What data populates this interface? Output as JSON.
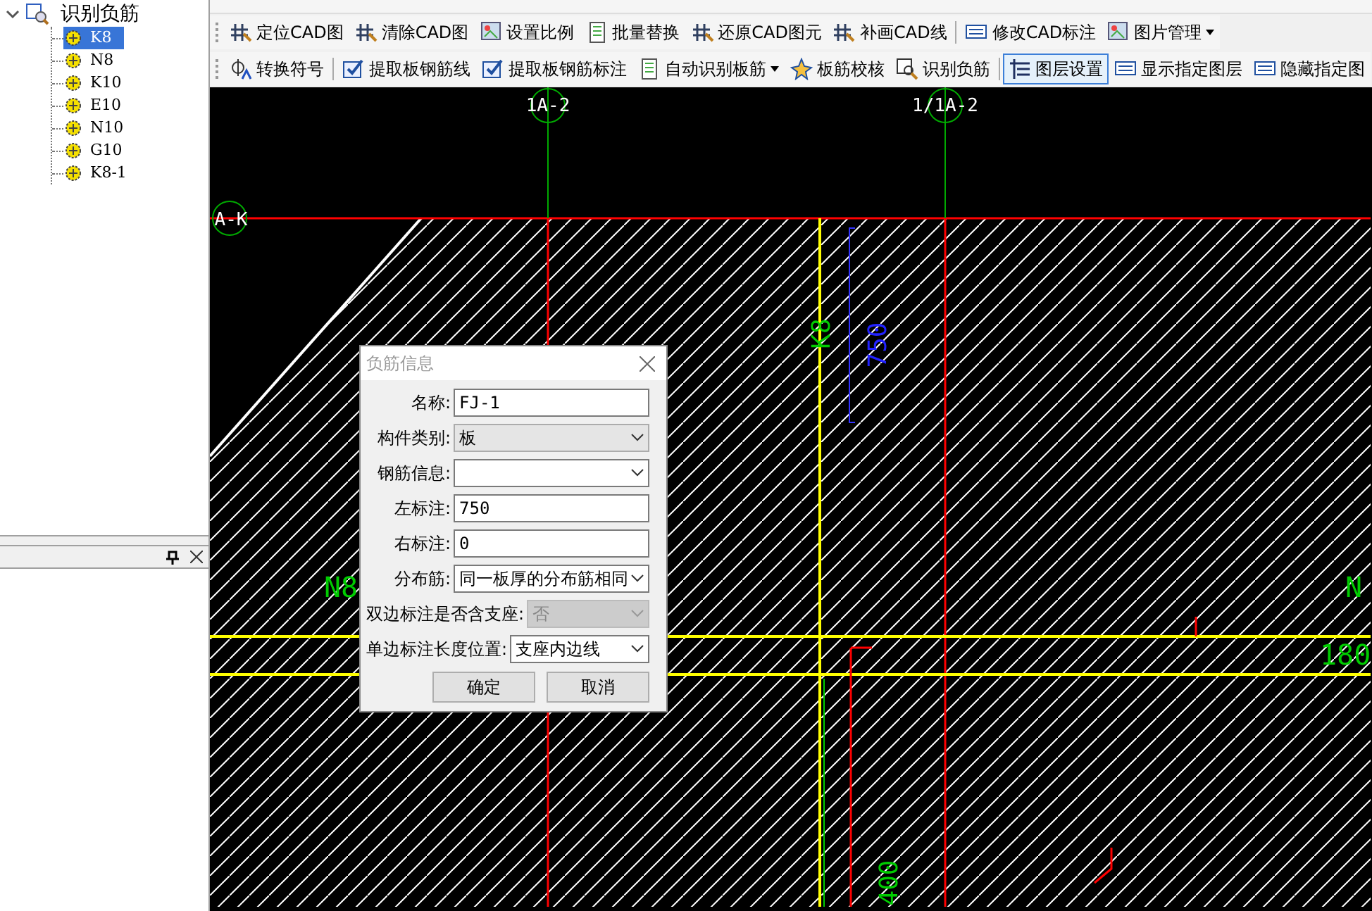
{
  "tree": {
    "label": "识别负筋",
    "expanded": true,
    "children": [
      {
        "label": "K8",
        "selected": true
      },
      {
        "label": "N8",
        "selected": false
      },
      {
        "label": "K10",
        "selected": false
      },
      {
        "label": "E10",
        "selected": false
      },
      {
        "label": "N10",
        "selected": false
      },
      {
        "label": "G10",
        "selected": false
      },
      {
        "label": "K8-1",
        "selected": false
      }
    ]
  },
  "toolbar_rows": [
    [
      {
        "label": "定位CAD图",
        "dropdown": false,
        "pressed": false
      },
      {
        "label": "清除CAD图",
        "dropdown": false,
        "pressed": false
      },
      {
        "label": "设置比例",
        "dropdown": false,
        "pressed": false
      },
      {
        "label": "批量替换",
        "dropdown": false,
        "pressed": false
      },
      {
        "label": "还原CAD图元",
        "dropdown": false,
        "pressed": false
      },
      {
        "label": "补画CAD线",
        "dropdown": false,
        "pressed": false
      },
      {
        "label": "修改CAD标注",
        "dropdown": false,
        "pressed": false
      },
      {
        "label": "图片管理",
        "dropdown": true,
        "pressed": false
      }
    ],
    [
      {
        "label": "转换符号",
        "dropdown": false,
        "pressed": false
      },
      {
        "label": "提取板钢筋线",
        "dropdown": false,
        "pressed": false
      },
      {
        "label": "提取板钢筋标注",
        "dropdown": false,
        "pressed": false
      },
      {
        "label": "自动识别板筋",
        "dropdown": true,
        "pressed": false
      },
      {
        "label": "板筋校核",
        "dropdown": false,
        "pressed": false
      },
      {
        "label": "识别负筋",
        "dropdown": false,
        "pressed": false
      },
      {
        "label": "图层设置",
        "dropdown": false,
        "pressed": true
      },
      {
        "label": "显示指定图层",
        "dropdown": false,
        "pressed": false
      },
      {
        "label": "隐藏指定图",
        "dropdown": false,
        "pressed": false
      }
    ]
  ],
  "canvas_labels": [
    "1A-2",
    "1/1A-2",
    "A-K",
    "K8",
    "750",
    "N8",
    "N",
    "180",
    "400"
  ],
  "dialog": {
    "title": "负筋信息",
    "active": false,
    "fields": [
      {
        "label": "名称:",
        "kind": "text",
        "value": "FJ-1",
        "disabled": false
      },
      {
        "label": "构件类别:",
        "kind": "select",
        "value": "板",
        "disabled": false
      },
      {
        "label": "钢筋信息:",
        "kind": "select",
        "disabled": false
      },
      {
        "label": "左标注:",
        "kind": "text",
        "value": "750",
        "disabled": false
      },
      {
        "label": "右标注:",
        "kind": "text",
        "value": "0",
        "disabled": false
      },
      {
        "label": "分布筋:",
        "kind": "select",
        "value": "同一板厚的分布筋相同",
        "disabled": false
      },
      {
        "label": "双边标注是否含支座:",
        "kind": "select",
        "value": "否",
        "disabled": true
      },
      {
        "label": "单边标注长度位置:",
        "kind": "select",
        "value": "支座内边线",
        "disabled": false
      }
    ],
    "buttons": [
      "确定",
      "取消"
    ]
  }
}
